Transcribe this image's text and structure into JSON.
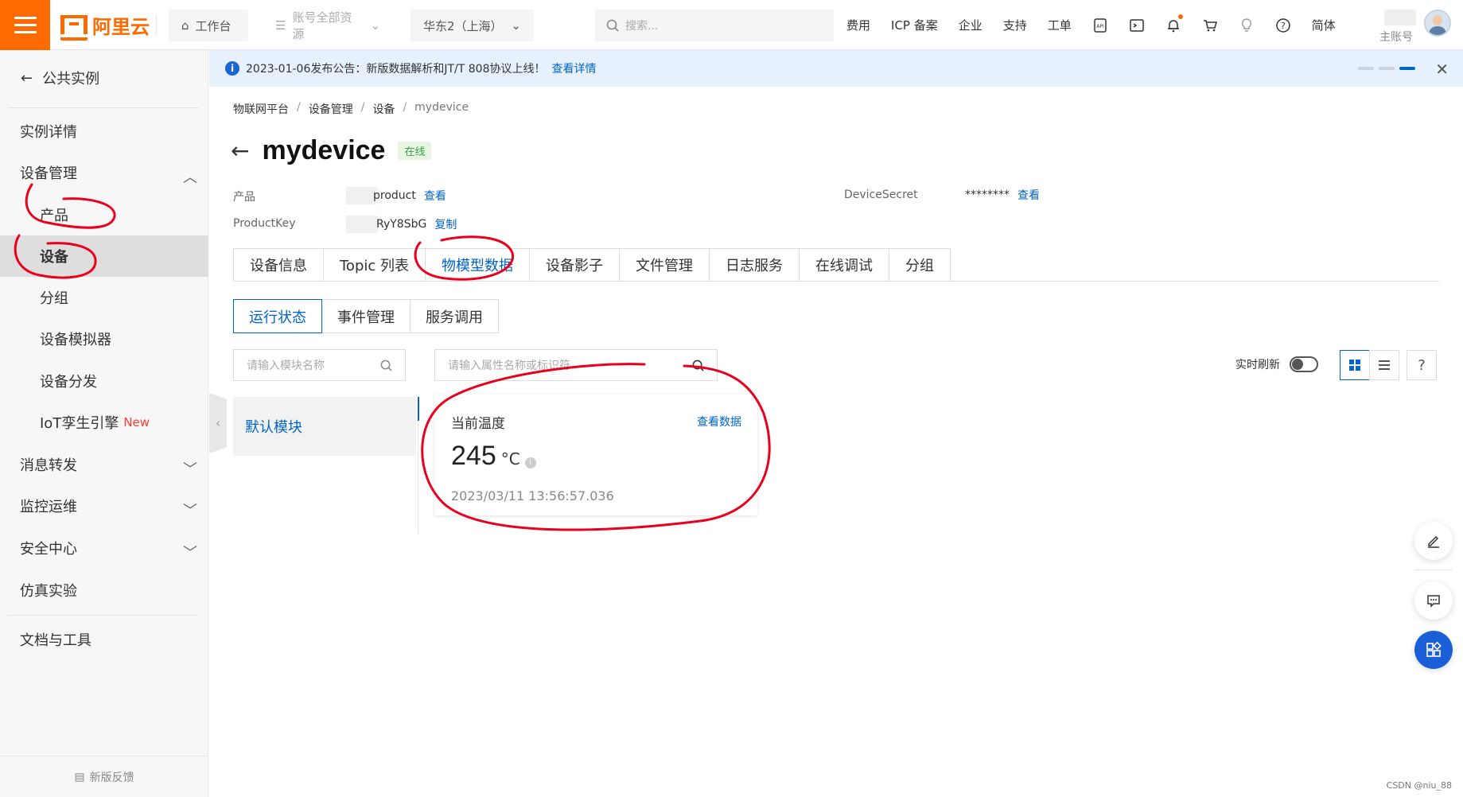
{
  "topbar": {
    "logo_text": "阿里云",
    "workbench": "工作台",
    "account_resources": "账号全部资源",
    "region": "华东2（上海）",
    "search_placeholder": "搜索...",
    "links": [
      "费用",
      "ICP 备案",
      "企业",
      "支持",
      "工单"
    ],
    "lang": "简体",
    "account_label": "主账号"
  },
  "sidebar": {
    "back_label": "公共实例",
    "items": [
      {
        "label": "实例详情"
      },
      {
        "label": "设备管理"
      },
      {
        "label": "产品"
      },
      {
        "label": "设备"
      },
      {
        "label": "分组"
      },
      {
        "label": "设备模拟器"
      },
      {
        "label": "设备分发"
      },
      {
        "label": "IoT孪生引擎",
        "badge": "New"
      },
      {
        "label": "消息转发"
      },
      {
        "label": "监控运维"
      },
      {
        "label": "安全中心"
      },
      {
        "label": "仿真实验"
      },
      {
        "label": "文档与工具"
      }
    ],
    "feedback": "新版反馈"
  },
  "announcement": {
    "text": "2023-01-06发布公告：新版数据解析和JT/T 808协议上线！",
    "link": "查看详情"
  },
  "breadcrumb": [
    "物联网平台",
    "设备管理",
    "设备",
    "mydevice"
  ],
  "device": {
    "name": "mydevice",
    "status": "在线",
    "product_label": "产品",
    "product_value": "product",
    "product_link": "查看",
    "productkey_label": "ProductKey",
    "productkey_value": "RyY8SbG",
    "productkey_link": "复制",
    "secret_label": "DeviceSecret",
    "secret_value": "********",
    "secret_link": "查看"
  },
  "tabs": [
    "设备信息",
    "Topic 列表",
    "物模型数据",
    "设备影子",
    "文件管理",
    "日志服务",
    "在线调试",
    "分组"
  ],
  "active_tab": "物模型数据",
  "subtabs": [
    "运行状态",
    "事件管理",
    "服务调用"
  ],
  "active_subtab": "运行状态",
  "module_search_placeholder": "请输入模块名称",
  "property_search_placeholder": "请输入属性名称或标识符",
  "modules": [
    "默认模块"
  ],
  "property": {
    "name": "当前温度",
    "link": "查看数据",
    "value": "245",
    "unit": "°C",
    "timestamp": "2023/03/11 13:56:57.036"
  },
  "realtime_refresh": "实时刷新",
  "watermark": "CSDN @niu_88",
  "colors": {
    "brand": "#ff6a00",
    "link": "#0064c8",
    "annotation": "#e8001c"
  }
}
